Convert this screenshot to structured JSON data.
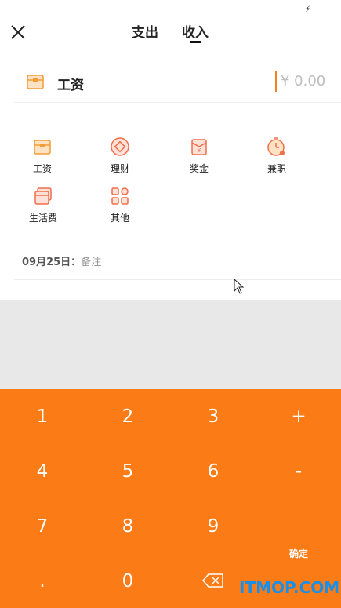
{
  "status_bar": {
    "icon": "lightning-bolt-icon"
  },
  "header": {
    "close_icon": "close-icon",
    "tabs": [
      {
        "label": "支出",
        "active": false
      },
      {
        "label": "收入",
        "active": true
      }
    ]
  },
  "amount": {
    "category_icon": "wallet-icon",
    "category_label": "工资",
    "value": "¥ 0.00",
    "accent_color": "#f5821f"
  },
  "categories": [
    {
      "label": "工资",
      "icon": "wallet-icon"
    },
    {
      "label": "理财",
      "icon": "coin-icon"
    },
    {
      "label": "奖金",
      "icon": "red-envelope-icon"
    },
    {
      "label": "兼职",
      "icon": "clock-icon"
    },
    {
      "label": "生活费",
      "icon": "cards-icon"
    },
    {
      "label": "其他",
      "icon": "grid-icon"
    }
  ],
  "note": {
    "date": "09月25日：",
    "placeholder": "备注"
  },
  "keypad": {
    "background_color": "#fb7b16",
    "keys": [
      "1",
      "2",
      "3",
      "+",
      "4",
      "5",
      "6",
      "-",
      "7",
      "8",
      "9",
      "确定",
      ".",
      "0"
    ],
    "backspace_icon": "backspace-icon"
  },
  "watermark": "ITMOP.COM"
}
